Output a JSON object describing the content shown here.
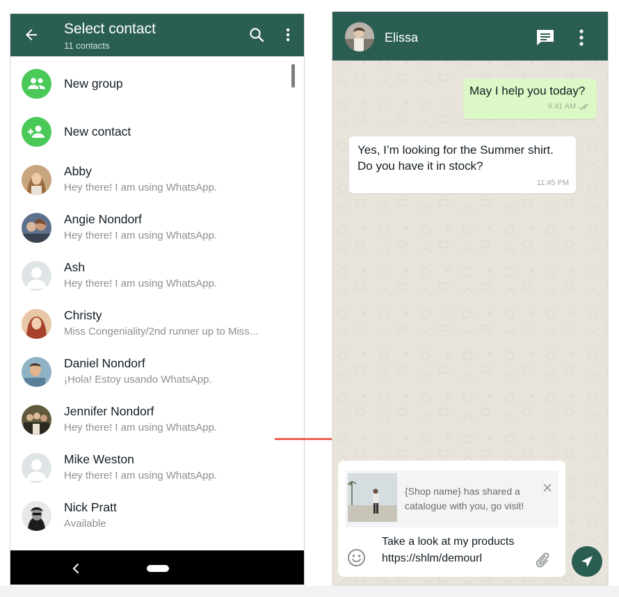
{
  "left_screen": {
    "header": {
      "title": "Select contact",
      "subtitle": "11 contacts",
      "back_icon": "arrow-left-icon",
      "search_icon": "search-icon",
      "more_icon": "more-vertical-icon"
    },
    "actions": [
      {
        "label": "New group",
        "icon": "group-icon",
        "color": "#4ac959"
      },
      {
        "label": "New contact",
        "icon": "add-person-icon",
        "color": "#4ac959"
      }
    ],
    "contacts": [
      {
        "name": "Abby",
        "status": "Hey there! I am using WhatsApp."
      },
      {
        "name": "Angie Nondorf",
        "status": "Hey there! I am using WhatsApp."
      },
      {
        "name": "Ash",
        "status": "Hey there! I am using WhatsApp."
      },
      {
        "name": "Christy",
        "status": "Miss Congeniality/2nd runner up to Miss..."
      },
      {
        "name": "Daniel Nondorf",
        "status": "¡Hola! Estoy usando WhatsApp."
      },
      {
        "name": "Jennifer Nondorf",
        "status": "Hey there! I am using WhatsApp."
      },
      {
        "name": "Mike Weston",
        "status": "Hey there! I am using WhatsApp."
      },
      {
        "name": "Nick Pratt",
        "status": "Available"
      }
    ],
    "nav": {
      "back_icon": "nav-back-icon",
      "home_icon": "home-pill-icon"
    }
  },
  "right_screen": {
    "header": {
      "contact_name": "Elissa",
      "chat_icon": "message-icon",
      "more_icon": "more-vertical-icon"
    },
    "messages": [
      {
        "direction": "out",
        "lines": [
          "May I help you today?"
        ],
        "time": "9.41 AM"
      },
      {
        "direction": "in",
        "lines": [
          "Yes, I’m looking for the Summer shirt.",
          "Do you have it in stock?"
        ],
        "time": "11:45 PM"
      }
    ],
    "link_preview": {
      "lines": [
        "{Shop name} has shared a",
        "catalogue with you, go visit!"
      ],
      "close_icon": "close-icon"
    },
    "input": {
      "lines": [
        "Take a look at my products",
        "https://shlm/demourl"
      ],
      "emoji_icon": "emoji-icon",
      "attach_icon": "paperclip-icon",
      "send_icon": "send-icon"
    }
  },
  "colors": {
    "header_green": "#2b5e53",
    "accent_green": "#4ac959",
    "outgoing_bubble": "#dcf8c6",
    "arrow_red": "#e8402f"
  }
}
